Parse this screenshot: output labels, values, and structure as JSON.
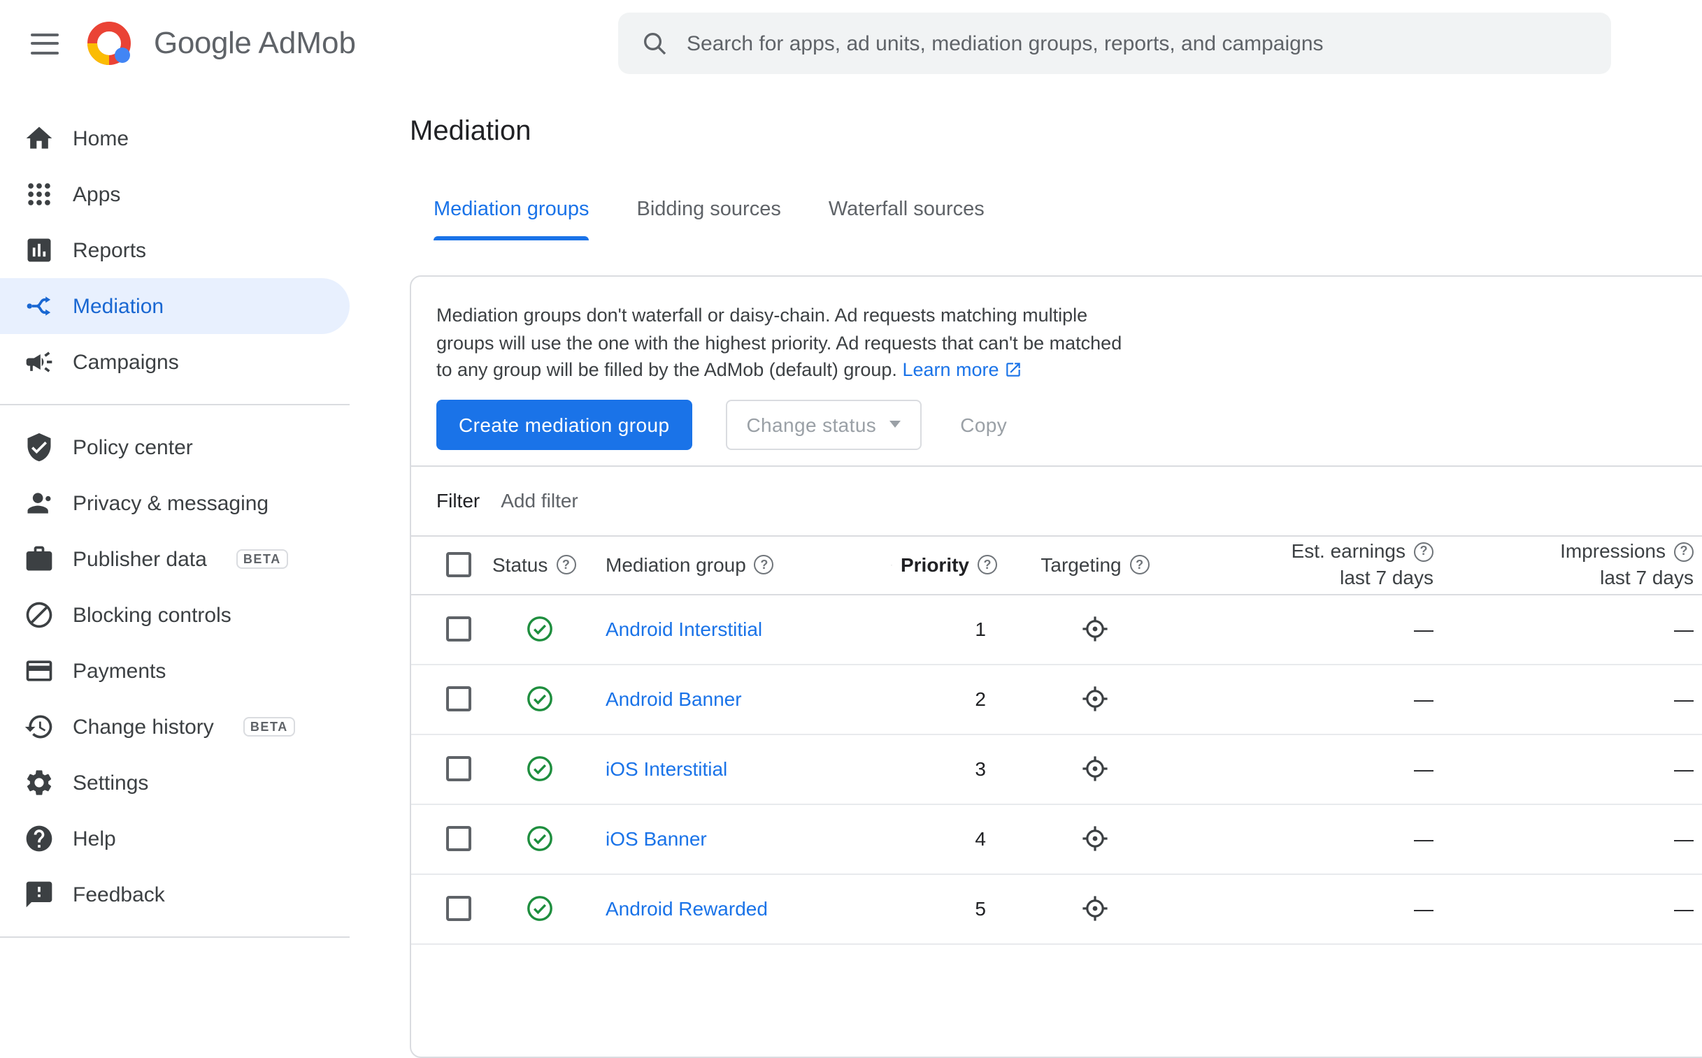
{
  "topbar": {
    "brand": {
      "google": "Google",
      "admob": "AdMob"
    },
    "search": {
      "placeholder": "Search for apps, ad units, mediation groups, reports, and campaigns"
    }
  },
  "sidebar": {
    "items": [
      {
        "label": "Home"
      },
      {
        "label": "Apps"
      },
      {
        "label": "Reports"
      },
      {
        "label": "Mediation"
      },
      {
        "label": "Campaigns"
      },
      {
        "label": "Policy center"
      },
      {
        "label": "Privacy & messaging"
      },
      {
        "label": "Publisher data",
        "badge": "BETA"
      },
      {
        "label": "Blocking controls"
      },
      {
        "label": "Payments"
      },
      {
        "label": "Change history",
        "badge": "BETA"
      },
      {
        "label": "Settings"
      },
      {
        "label": "Help"
      },
      {
        "label": "Feedback"
      }
    ]
  },
  "page": {
    "title": "Mediation",
    "tabs": [
      {
        "label": "Mediation groups"
      },
      {
        "label": "Bidding sources"
      },
      {
        "label": "Waterfall sources"
      }
    ],
    "intro": {
      "text": "Mediation groups don't waterfall or daisy-chain. Ad requests matching multiple groups will use the one with the highest priority. Ad requests that can't be matched to any group will be filled by the AdMob (default) group.",
      "learn_more_label": "Learn more"
    },
    "actions": {
      "create_label": "Create mediation group",
      "change_status_label": "Change status",
      "copy_label": "Copy"
    },
    "filter": {
      "label": "Filter",
      "add_filter_label": "Add filter"
    }
  },
  "table": {
    "headers": {
      "status": "Status",
      "mediation_group": "Mediation group",
      "priority": "Priority",
      "targeting": "Targeting",
      "est_earnings": "Est. earnings",
      "impressions": "Impressions",
      "subheader_last_7_days": "last 7 days"
    },
    "rows": [
      {
        "status": "enabled",
        "name": "Android Interstitial",
        "priority": "1",
        "est_earnings": "—",
        "impressions": "—"
      },
      {
        "status": "enabled",
        "name": "Android Banner",
        "priority": "2",
        "est_earnings": "—",
        "impressions": "—"
      },
      {
        "status": "enabled",
        "name": "iOS Interstitial",
        "priority": "3",
        "est_earnings": "—",
        "impressions": "—"
      },
      {
        "status": "enabled",
        "name": "iOS Banner",
        "priority": "4",
        "est_earnings": "—",
        "impressions": "—"
      },
      {
        "status": "enabled",
        "name": "Android Rewarded",
        "priority": "5",
        "est_earnings": "—",
        "impressions": "—"
      }
    ]
  },
  "colors": {
    "accent_blue": "#1a73e8",
    "active_nav_blue": "#1967d2",
    "active_nav_bg": "#e8f0fe",
    "status_green": "#1e8e3e",
    "text_primary": "#202124",
    "text_secondary": "#5f6368",
    "border": "#dadce0",
    "search_bg": "#f1f3f4"
  }
}
